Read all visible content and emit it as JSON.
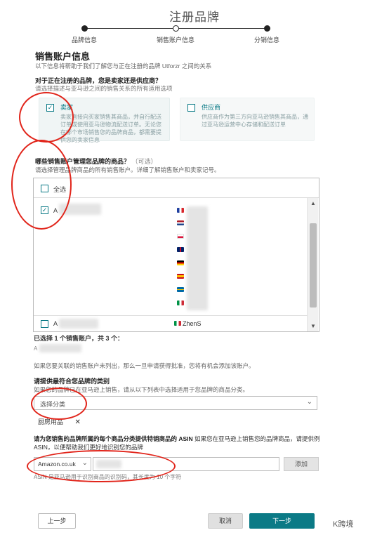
{
  "page": {
    "title": "注册品牌",
    "steps": [
      "品牌信息",
      "销售账户信息",
      "分销信息"
    ]
  },
  "section": {
    "heading": "销售账户信息",
    "subheading": "以下信息将帮助于我们了解您与正在注册的品牌 Utforzr 之间的关系"
  },
  "relationship": {
    "question": "对于正在注册的品牌，您是卖家还是供应商？",
    "hint": "请选择描述与亚马逊之间的销售关系的所有适用选项",
    "seller": {
      "checked": true,
      "check_glyph": "✓",
      "title": "卖家",
      "desc": "卖家直接向买家销售其商品，并自行配送订单或使用亚马逊物流配送订单。无论您在哪个市场销售您的品牌商品，都需要提供您的卖家信息"
    },
    "vendor": {
      "checked": false,
      "title": "供应商",
      "desc": "供应商作为第三方向亚马逊销售其商品，通过亚马逊运营中心存储和配送订单"
    }
  },
  "accounts": {
    "question": "哪些销售账户管理您品牌的商品？",
    "optional": "（可选）",
    "hint": "请选择管理品牌商品的所有销售账户。详细了解销售账户和卖家记号。",
    "select_all": "全选",
    "first_account": "A",
    "first_checked": true,
    "last_account": "A",
    "last_store": "ZhenS",
    "scroll_up": "▲",
    "scroll_down": "▼"
  },
  "summary": {
    "selected": "已选择 1 个销售账户，共 3 个：",
    "asin_prefix": "A",
    "note": "如果您要关联的销售账户未列出，那么一旦申请获得批准，您将有机会添加该账户。"
  },
  "category": {
    "question": "请提供最符合您品牌的类别",
    "hint": "如果您的品牌已在亚马逊上销售，请从以下列表中选择适用于您品牌的商品分类。",
    "placeholder": "选择分类",
    "chevron": "⌄",
    "tag": "厨房用品",
    "tag_remove": "✕"
  },
  "asin": {
    "question_bold": "请为您销售的品牌所属的每个商品分类提供特销商品的 ASIN",
    "question_rest": " 如果您在亚马逊上销售您的品牌商品，请提供例ASIN，以便帮助我们更好地识别您的品牌",
    "marketplace": "Amazon.co.uk",
    "chevron": "⌄",
    "add": "添加",
    "hint": "ASIN 是亚马逊用于识别商品的识别码，其长度为 10 个字符"
  },
  "footer": {
    "prev": "上一步",
    "cancel": "取消",
    "next": "下一步",
    "watermark": "K跨境"
  },
  "colors": {
    "accent": "#0b7a86",
    "annotation": "#e1251b",
    "selected_bg": "#f0f5f5"
  },
  "flags": [
    {
      "name": "france-flag",
      "colors": [
        "#1f3f9f",
        "#ffffff",
        "#d8262b"
      ]
    },
    {
      "name": "netherlands-flag",
      "colors": [
        "#ae1c28",
        "#ffffff",
        "#21468b"
      ]
    },
    {
      "name": "poland-flag",
      "colors": [
        "#ffffff",
        "#dc143c"
      ]
    },
    {
      "name": "uk-flag",
      "colors": [
        "#012169",
        "#c8102e"
      ]
    },
    {
      "name": "germany-flag",
      "colors": [
        "#000000",
        "#dd0000",
        "#ffce00"
      ]
    },
    {
      "name": "spain-flag",
      "colors": [
        "#c60b1e",
        "#ffc400",
        "#c60b1e"
      ]
    },
    {
      "name": "sweden-flag",
      "colors": [
        "#006aa7",
        "#fecc00"
      ]
    },
    {
      "name": "italy-flag",
      "colors": [
        "#009246",
        "#ffffff",
        "#ce2b37"
      ]
    }
  ]
}
